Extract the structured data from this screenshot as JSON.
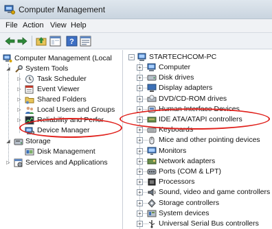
{
  "window": {
    "title": "Computer Management"
  },
  "menu": [
    "File",
    "Action",
    "View",
    "Help"
  ],
  "left_tree": [
    {
      "label": "Computer Management (Local",
      "icon": "computer-management-icon"
    },
    {
      "label": "System Tools",
      "icon": "tools-icon"
    },
    {
      "label": "Task Scheduler",
      "icon": "clock-icon"
    },
    {
      "label": "Event Viewer",
      "icon": "event-viewer-icon"
    },
    {
      "label": "Shared Folders",
      "icon": "shared-folder-icon"
    },
    {
      "label": "Local Users and Groups",
      "icon": "users-icon"
    },
    {
      "label": "Reliability and Perfor",
      "icon": "performance-icon"
    },
    {
      "label": "Device Manager",
      "icon": "device-manager-icon"
    },
    {
      "label": "Storage",
      "icon": "storage-icon"
    },
    {
      "label": "Disk Management",
      "icon": "disk-management-icon"
    },
    {
      "label": "Services and Applications",
      "icon": "services-icon"
    }
  ],
  "device_tree": {
    "root": "STARTECHCOM-PC",
    "categories": [
      {
        "label": "Computer",
        "icon": "computer-icon"
      },
      {
        "label": "Disk drives",
        "icon": "disk-drive-icon"
      },
      {
        "label": "Display adapters",
        "icon": "display-adapter-icon"
      },
      {
        "label": "DVD/CD-ROM drives",
        "icon": "dvd-icon"
      },
      {
        "label": "Human Interface Devices",
        "icon": "hid-icon"
      },
      {
        "label": "IDE ATA/ATAPI controllers",
        "icon": "ide-controller-icon"
      },
      {
        "label": "Keyboards",
        "icon": "keyboard-icon"
      },
      {
        "label": "Mice and other pointing devices",
        "icon": "mouse-icon"
      },
      {
        "label": "Monitors",
        "icon": "monitor-icon"
      },
      {
        "label": "Network adapters",
        "icon": "network-adapter-icon"
      },
      {
        "label": "Ports (COM & LPT)",
        "icon": "port-icon"
      },
      {
        "label": "Processors",
        "icon": "processor-icon"
      },
      {
        "label": "Sound, video and game controllers",
        "icon": "sound-icon"
      },
      {
        "label": "Storage controllers",
        "icon": "storage-controller-icon"
      },
      {
        "label": "System devices",
        "icon": "system-devices-icon"
      },
      {
        "label": "Universal Serial Bus controllers",
        "icon": "usb-icon"
      }
    ]
  },
  "colors": {
    "annotation": "#e0201b"
  }
}
